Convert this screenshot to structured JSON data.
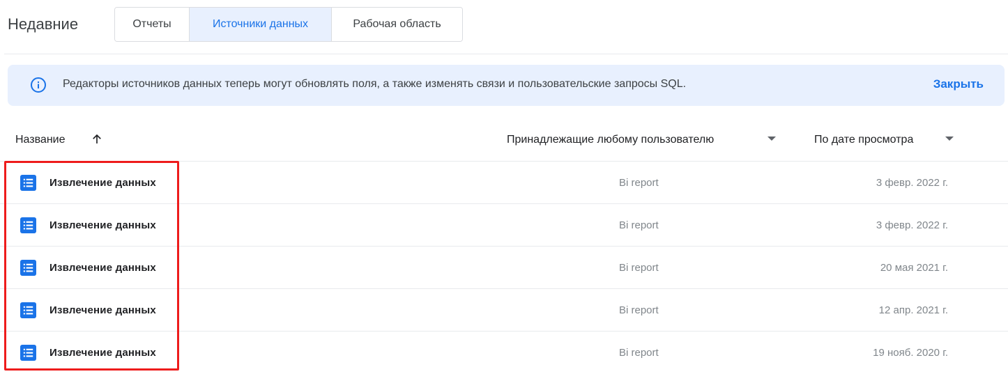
{
  "header": {
    "title": "Недавние",
    "tabs": [
      {
        "label": "Отчеты",
        "active": false
      },
      {
        "label": "Источники данных",
        "active": true
      },
      {
        "label": "Рабочая область",
        "active": false
      }
    ]
  },
  "banner": {
    "icon": "info-icon",
    "text": "Редакторы источников данных теперь могут обновлять поля, а также изменять связи и пользовательские запросы SQL.",
    "close_label": "Закрыть"
  },
  "table": {
    "columns": {
      "name": "Название",
      "owner": "Принадлежащие любому пользователю",
      "date": "По дате просмотра"
    },
    "rows": [
      {
        "icon": "data-source-icon",
        "name": "Извлечение данных",
        "owner": "Bi report",
        "date": "3 февр. 2022 г."
      },
      {
        "icon": "data-source-icon",
        "name": "Извлечение данных",
        "owner": "Bi report",
        "date": "3 февр. 2022 г."
      },
      {
        "icon": "data-source-icon",
        "name": "Извлечение данных",
        "owner": "Bi report",
        "date": "20 мая 2021 г."
      },
      {
        "icon": "data-source-icon",
        "name": "Извлечение данных",
        "owner": "Bi report",
        "date": "12 апр. 2021 г."
      },
      {
        "icon": "data-source-icon",
        "name": "Извлечение данных",
        "owner": "Bi report",
        "date": "19 нояб. 2020 г."
      }
    ]
  },
  "colors": {
    "accent": "#1a73e8",
    "banner_bg": "#e8f0fe",
    "highlight": "#ee1c1c"
  }
}
